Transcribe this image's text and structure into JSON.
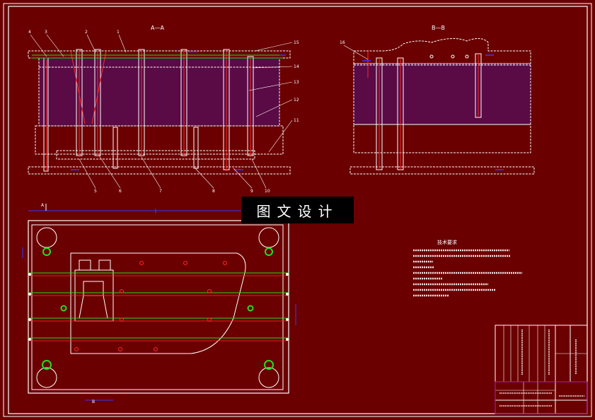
{
  "drawing": {
    "section_a_title": "A—A",
    "section_b_title": "B—B",
    "watermark": "图文设计",
    "view_marker_a": "A",
    "view_marker_b": "B",
    "tech_title": "技术要求",
    "callouts_top": [
      "4",
      "3",
      "2",
      "1"
    ],
    "callouts_bottom": [
      "5",
      "6",
      "7",
      "8",
      "9",
      "10"
    ],
    "callouts_right": [
      "15",
      "14",
      "13",
      "12",
      "11"
    ],
    "callout_b": "16"
  },
  "colors": {
    "background": "#6b0000",
    "line_white": "#ffffff",
    "line_blue": "#2f3cff",
    "line_green": "#22dd22",
    "line_red": "#ff2a2a",
    "cavity_fill": "#5a0a44"
  }
}
